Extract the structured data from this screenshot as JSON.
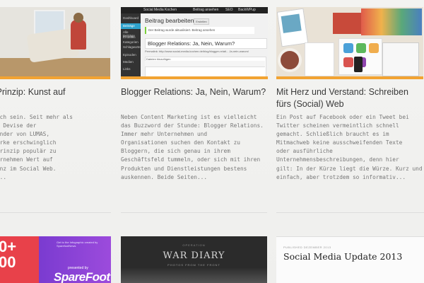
{
  "posts": [
    {
      "title": "LUMAS Prinzip: Kunst auf\nk",
      "excerpt": " erschwinglich sein. Seit mehr als\nutet so die Devise der\nsterten Gründer von LUMAS,\nafiekunstwerke erschwinglich\n das LUMAS Prinzip populär zu\nst das Unternehmen Wert auf\nsende Präsenz im Social Web.\nechend ist..."
    },
    {
      "title": "Blogger Relations: Ja, Nein, Warum?",
      "excerpt": "Neben Content Marketing ist es vielleicht\ndas Buzzword der Stunde: Blogger Relations.\nImmer mehr Unternehmen und\nOrganisationen suchen den Kontakt zu\nBloggern, die sich genau in ihrem\nGeschäftsfeld tummeln, oder sich mit ihren\nProdukten und Dienstleistungen bestens\nauskennen. Beide Seiten...",
      "thumb": {
        "adminbar": [
          "Social Media Kochen",
          "Beitrag ansehen",
          "SEO",
          "BackWPup"
        ],
        "menu": [
          "Dashboard",
          "Beiträge",
          "Alle Beiträge",
          "Erstellen",
          "Kategorien",
          "Schlagworte",
          "Episoden",
          "Medien",
          "Links"
        ],
        "heading": "Beitrag bearbeiten",
        "heading_button": "Erstellen",
        "notice": "Der Beitrag wurde aktualisiert. Beitrag ansehen",
        "post_title": "Blogger Relations: Ja, Nein, Warum?",
        "permalink": "Permalink: http://www.social-media-kochen.de/blog/blogger-relati... Ja-nein-warum/",
        "media_button": "Dateien hinzufügen"
      }
    },
    {
      "title": "Mit Herz und Verstand: Schreiben\nfürs (Social) Web",
      "excerpt": "Ein Post auf Facebook oder ein Tweet bei\nTwitter scheinen vermeintlich schnell\ngemacht. Schließlich braucht es im\nMitmachweb keine ausschweifenden Texte\noder ausführliche\nUnternehmensbeschreibungen, denn hier\ngilt: In der Kürze liegt die Würze. Kurz und\neinfach, aber trotzdem so informativ..."
    }
  ],
  "bottom": {
    "b1": {
      "big1": "0+",
      "big2": "00",
      "small": "Get to the Infographic created by SparefootNews",
      "presented": "presented by",
      "brand": "SpareFoot"
    },
    "b2": {
      "kicker": "OPERATION",
      "main": "WAR DIARY",
      "subline": "PHOTOS FROM THE FRONT"
    },
    "b3": {
      "kicker": "PUBLISHED DEZEMBER 2013",
      "main": "Social Media Update 2013"
    }
  },
  "colors": {
    "accent": "#f2a332",
    "title": "#3a3a3a",
    "excerpt": "#777777"
  }
}
